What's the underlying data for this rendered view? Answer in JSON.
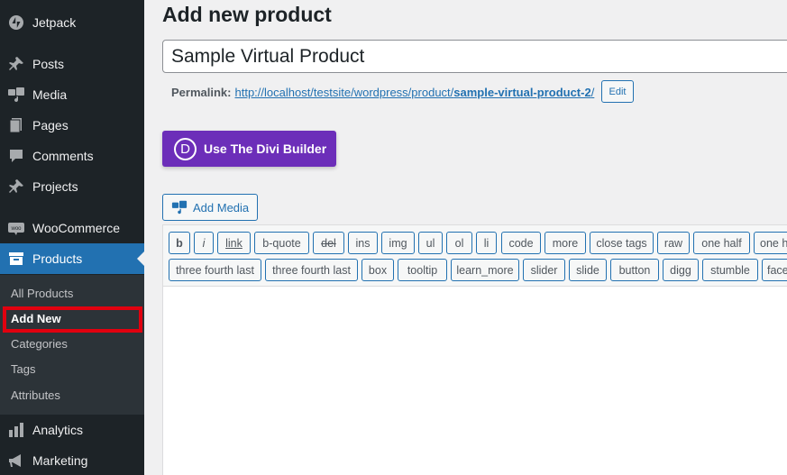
{
  "sidebar": {
    "items": [
      {
        "label": "Jetpack",
        "icon": "jetpack-icon"
      },
      {
        "label": "Posts",
        "icon": "pin-icon"
      },
      {
        "label": "Media",
        "icon": "media-icon"
      },
      {
        "label": "Pages",
        "icon": "pages-icon"
      },
      {
        "label": "Comments",
        "icon": "comment-icon"
      },
      {
        "label": "Projects",
        "icon": "pin-icon"
      },
      {
        "label": "WooCommerce",
        "icon": "woo-icon"
      },
      {
        "label": "Products",
        "icon": "archive-icon"
      },
      {
        "label": "Analytics",
        "icon": "chart-icon"
      },
      {
        "label": "Marketing",
        "icon": "megaphone-icon"
      }
    ],
    "submenu": [
      "All Products",
      "Add New",
      "Categories",
      "Tags",
      "Attributes"
    ],
    "active_color": "#2271b1"
  },
  "main": {
    "page_title": "Add new product",
    "title_value": "Sample Virtual Product",
    "permalink": {
      "label": "Permalink:",
      "base": "http://localhost/testsite/wordpress/product/",
      "slug": "sample-virtual-product-2",
      "trail": "/",
      "edit_label": "Edit"
    },
    "divi_button": {
      "logo": "D",
      "label": "Use The Divi Builder",
      "color": "#6c2eb9"
    },
    "add_media_label": "Add Media",
    "quicktags_row1": [
      "b",
      "i",
      "link",
      "b-quote",
      "del",
      "ins",
      "img",
      "ul",
      "ol",
      "li",
      "code",
      "more",
      "close tags",
      "raw",
      "one half",
      "one h"
    ],
    "quicktags_row2": [
      "three fourth last",
      "three fourth last",
      "box",
      "tooltip",
      "learn_more",
      "slider",
      "slide",
      "button",
      "digg",
      "stumble",
      "face"
    ]
  }
}
